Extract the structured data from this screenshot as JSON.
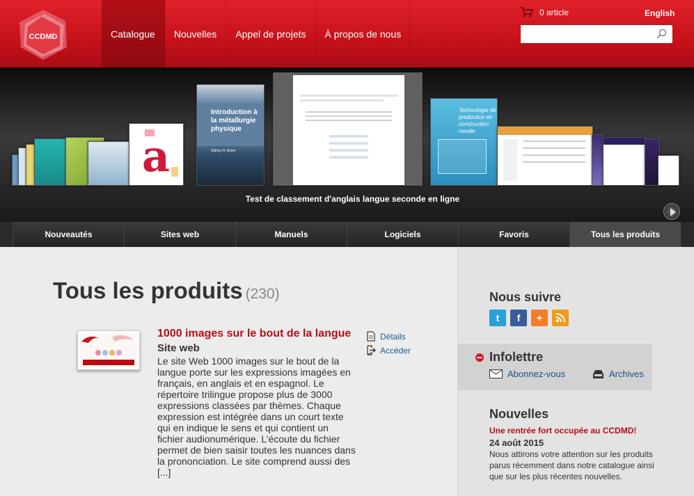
{
  "header": {
    "logo_text": "CCDMD",
    "nav": [
      "Catalogue",
      "Nouvelles",
      "Appel de projets",
      "À propos de nous"
    ],
    "cart": "0 article",
    "language": "English",
    "search_placeholder": ""
  },
  "carousel": {
    "featured_caption": "Test de classement d'anglais langue seconde en ligne",
    "book_title": "Introduction à la métallurgie physique",
    "book_author": "Sidney H. Avner",
    "book2_title": "Technologie de production en construction navale"
  },
  "tabs": [
    "Nouveautés",
    "Sites web",
    "Manuels",
    "Logiciels",
    "Favoris",
    "Tous les produits"
  ],
  "main": {
    "title": "Tous les produits",
    "count": "(230)",
    "product": {
      "title": "1000 images sur le bout de la langue",
      "type": "Site web",
      "description": "Le site Web 1000 images sur le bout de la langue porte sur les expressions imagées en français, en anglais et en espagnol. Le répertoire trilingue propose plus de 3000 expressions classées par thèmes. Chaque expression est intégrée dans un court texte qui en indique le sens et qui contient un fichier audionumérique. L’écoute du fichier permet de bien saisir toutes les nuances dans la prononciation. Le site comprend aussi des [...]",
      "details_label": "Détails",
      "access_label": "Accéder"
    }
  },
  "sidebar": {
    "follow_title": "Nous suivre",
    "newsletter_title": "Infolettre",
    "subscribe_label": "Abonnez-vous",
    "archives_label": "Archives",
    "news_title": "Nouvelles",
    "news_item_title": "Une rentrée fort occupée au CCDMD!",
    "news_item_date": "24 août 2015",
    "news_item_body": "Nous attirons votre attention sur les produits parus récemment dans notre catalogue ainsi que sur les plus récentes nouvelles."
  },
  "colors": {
    "brand_red": "#c6111a",
    "link_blue": "#1b5a93"
  }
}
